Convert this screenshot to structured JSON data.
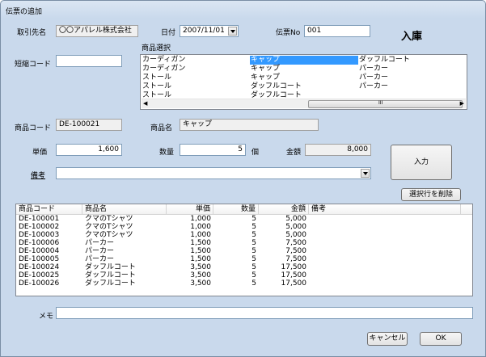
{
  "window": {
    "title": "伝票の追加"
  },
  "form": {
    "customer_label": "取引先名",
    "customer_value": "〇〇アパレル株式会社",
    "date_label": "日付",
    "date_value": "2007/11/01",
    "slip_no_label": "伝票No",
    "slip_no_value": "001",
    "mode_title": "入庫",
    "product_select_label": "商品選択",
    "short_code_label": "短縮コード",
    "short_code_value": "",
    "product_code_label": "商品コード",
    "product_code_value": "DE-100021",
    "product_name_label": "商品名",
    "product_name_value": "キャップ",
    "unit_price_label": "単価",
    "unit_price_value": "1,600",
    "quantity_label": "数量",
    "quantity_value": "5",
    "quantity_unit": "個",
    "amount_label": "金額",
    "amount_value": "8,000",
    "remarks_label": "備考",
    "remarks_value": "",
    "input_button": "入力",
    "delete_rows_button": "選択行を削除",
    "memo_label": "メモ",
    "memo_value": "",
    "cancel_button": "キャンセル",
    "ok_button": "OK",
    "scroll_thumb_glyph": "III"
  },
  "product_list": {
    "columns": [
      [
        "カーディガン",
        "カーディガン",
        "ストール",
        "ストール",
        "ストール"
      ],
      [
        "キャップ",
        "キャップ",
        "キャップ",
        "ダッフルコート",
        "ダッフルコート"
      ],
      [
        "ダッフルコート",
        "パーカー",
        "パーカー",
        "パーカー"
      ]
    ],
    "selected_column": 1,
    "selected_row": 0
  },
  "detail_table": {
    "headers": [
      "商品コード",
      "商品名",
      "単価",
      "数量",
      "金額",
      "備考"
    ],
    "rows": [
      [
        "DE-100001",
        "クマのTシャツ",
        "1,000",
        "5",
        "5,000",
        ""
      ],
      [
        "DE-100002",
        "クマのTシャツ",
        "1,000",
        "5",
        "5,000",
        ""
      ],
      [
        "DE-100003",
        "クマのTシャツ",
        "1,000",
        "5",
        "5,000",
        ""
      ],
      [
        "DE-100006",
        "パーカー",
        "1,500",
        "5",
        "7,500",
        ""
      ],
      [
        "DE-100004",
        "パーカー",
        "1,500",
        "5",
        "7,500",
        ""
      ],
      [
        "DE-100005",
        "パーカー",
        "1,500",
        "5",
        "7,500",
        ""
      ],
      [
        "DE-100024",
        "ダッフルコート",
        "3,500",
        "5",
        "17,500",
        ""
      ],
      [
        "DE-100025",
        "ダッフルコート",
        "3,500",
        "5",
        "17,500",
        ""
      ],
      [
        "DE-100026",
        "ダッフルコート",
        "3,500",
        "5",
        "17,500",
        ""
      ]
    ]
  }
}
